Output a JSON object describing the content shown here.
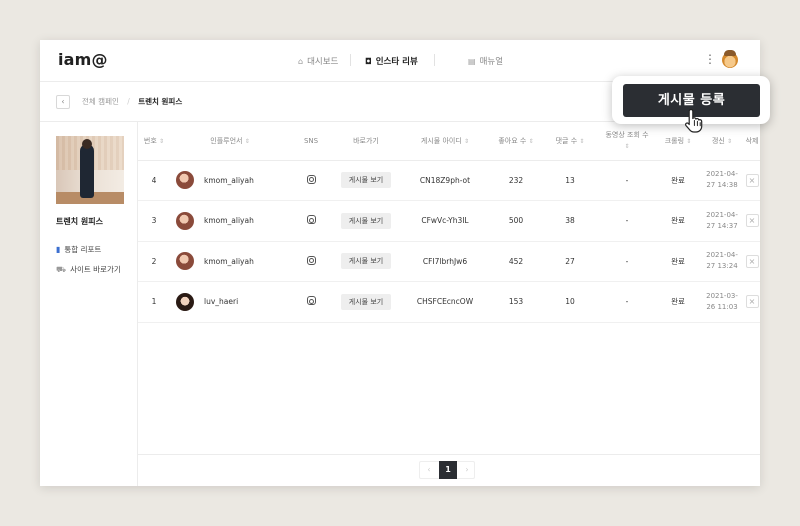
{
  "app": {
    "logo": "iam@"
  },
  "nav": {
    "items": [
      {
        "label": "대시보드",
        "icon": "home-icon",
        "glyph": "⌂"
      },
      {
        "label": "인스타 리뷰",
        "icon": "instagram-icon",
        "glyph": "◘"
      },
      {
        "label": "매뉴얼",
        "icon": "manual-icon",
        "glyph": "▤"
      }
    ],
    "more_glyph": "⋮"
  },
  "breadcrumb": {
    "back": "‹",
    "parent": "전체 캠페인",
    "sep": "/",
    "current": "트렌치 원피스"
  },
  "sidebar": {
    "title": "트렌치 원피스",
    "links": [
      {
        "label": "통합 리포트",
        "icon": "bar-chart-icon",
        "glyph": "▮"
      },
      {
        "label": "사이트 바로가기",
        "icon": "cart-icon",
        "glyph": "⛟"
      }
    ]
  },
  "table": {
    "sort_glyph": "⇕",
    "headers": [
      "번호",
      "인플루언서",
      "SNS",
      "바로가기",
      "게시물 아이디",
      "좋아요 수",
      "댓글 수",
      "동영상 조회 수",
      "크롤링",
      "갱신",
      "삭제"
    ],
    "view_label": "게시물 보기",
    "delete_glyph": "×",
    "rows": [
      {
        "no": "4",
        "influencer": "kmom_aliyah",
        "post_id": "CN18Z9ph-ot",
        "likes": "232",
        "comments": "13",
        "views": "-",
        "crawl": "완료",
        "date": "2021-04-",
        "time": "27 14:38"
      },
      {
        "no": "3",
        "influencer": "kmom_aliyah",
        "post_id": "CFwVc-Yh3IL",
        "likes": "500",
        "comments": "38",
        "views": "-",
        "crawl": "완료",
        "date": "2021-04-",
        "time": "27 14:37"
      },
      {
        "no": "2",
        "influencer": "kmom_aliyah",
        "post_id": "CFI7lbrhJw6",
        "likes": "452",
        "comments": "27",
        "views": "-",
        "crawl": "완료",
        "date": "2021-04-",
        "time": "27 13:24"
      },
      {
        "no": "1",
        "influencer": "luv_haeri",
        "post_id": "CHSFCEcncOW",
        "likes": "153",
        "comments": "10",
        "views": "-",
        "crawl": "완료",
        "date": "2021-03-",
        "time": "26 11:03"
      }
    ]
  },
  "pagination": {
    "prev": "‹",
    "current": "1",
    "next": "›"
  },
  "cta": {
    "label": "게시물 등록"
  },
  "colors": {
    "accent": "#2b2e33",
    "background": "#ebe8e2"
  }
}
